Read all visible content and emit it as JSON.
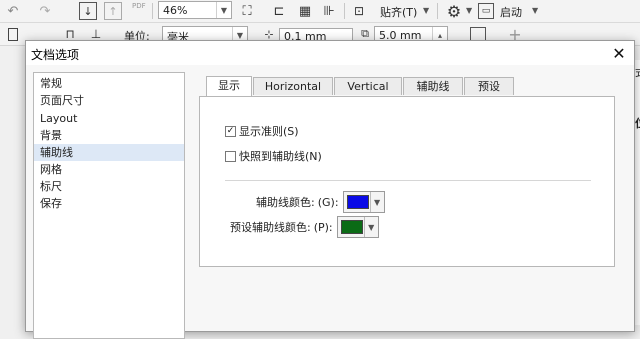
{
  "toolbar": {
    "pdf_label": "PDF",
    "zoom_value": "46%",
    "snap_label": "贴齐(T)",
    "launch_label": "启动"
  },
  "propertybar": {
    "units_label": "单位:",
    "units_value": "毫米",
    "nudge_value": "0.1 mm",
    "dup_value": "5.0 mm"
  },
  "dialog": {
    "title": "文档选项",
    "nav": [
      {
        "label": "常规"
      },
      {
        "label": "页面尺寸"
      },
      {
        "label": "Layout"
      },
      {
        "label": "背景"
      },
      {
        "label": "辅助线",
        "selected": true
      },
      {
        "label": "网格"
      },
      {
        "label": "标尺"
      },
      {
        "label": "保存"
      }
    ],
    "tabs": [
      {
        "label": "显示",
        "active": true
      },
      {
        "label": "Horizontal"
      },
      {
        "label": "Vertical"
      },
      {
        "label": "辅助线"
      },
      {
        "label": "预设"
      }
    ],
    "show_guides": {
      "label": "显示准则(S)",
      "checked": true
    },
    "snap_guides": {
      "label": "快照到辅助线(N)",
      "checked": false
    },
    "guide_color": {
      "label": "辅助线颜色:",
      "key": "(G):",
      "color": "#0a0ae6"
    },
    "preset_color": {
      "label": "预设辅助线颜色:",
      "key": "(P):",
      "color": "#0b6b16"
    }
  },
  "right_fragments": {
    "a": "式",
    "b": "位"
  }
}
